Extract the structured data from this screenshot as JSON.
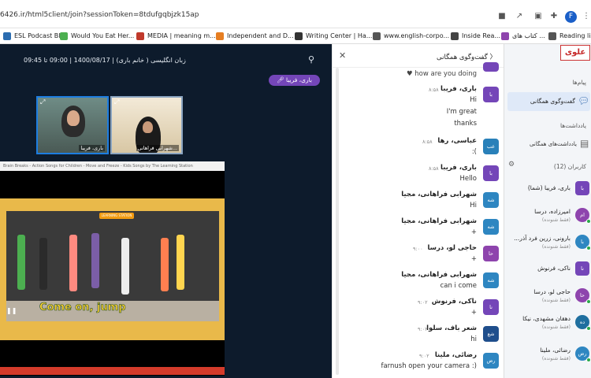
{
  "browser": {
    "url": "6426.ir/html5client/join?sessionToken=8tdufgqbjzk15ap",
    "avatar_letter": "F",
    "bookmarks": [
      {
        "label": "ESL Podcast Blog",
        "color": "#2b6cb0"
      },
      {
        "label": "Would You Eat Her...",
        "color": "#4caf50"
      },
      {
        "label": "MEDIA | meaning m...",
        "color": "#c0392b"
      },
      {
        "label": "Independent and D...",
        "color": "#e67e22"
      },
      {
        "label": "Writing Center | Ha...",
        "color": "#333333"
      },
      {
        "label": "www.english-corpo...",
        "color": "#555555"
      },
      {
        "label": "Inside Rea...",
        "color": "#444444"
      },
      {
        "label": "کتاب های ...",
        "color": "#8e44ad"
      },
      {
        "label": "Reading list",
        "color": "#555555"
      }
    ]
  },
  "session": {
    "title": "زبان انگلیسی ( خانم باری) | 1400/08/17 | 09:00 تا 09:45",
    "talking": "باری، فریبا",
    "cams": [
      {
        "name": "باری، فریبا"
      },
      {
        "name": "شهرابی فراهانی..."
      }
    ],
    "screenshare_title": "Brain Breaks - Action Songs for Children - Move and Freeze - Kids Songs by The Learning Station",
    "caption": "Come on, jump",
    "badge": "LEARNING STATION"
  },
  "chat": {
    "title": "گفت‌وگوی همگانی",
    "messages": [
      {
        "name": "",
        "time": "",
        "lines": [
          "♥ how are you doing"
        ],
        "avatar": "",
        "color": ""
      },
      {
        "name": "باری، فریبا",
        "time": "۸:۵۸",
        "lines": [
          "Hi",
          "I'm great",
          "thanks"
        ],
        "avatar": "با",
        "color": "#7446b8"
      },
      {
        "name": "عباسی، رها",
        "time": "۸:۵۸",
        "lines": [
          ":("
        ],
        "avatar": "عب",
        "color": "#2980b9"
      },
      {
        "name": "باری، فریبا",
        "time": "۸:۵۸",
        "lines": [
          "Hello"
        ],
        "avatar": "با",
        "color": "#7446b8"
      },
      {
        "name": "شهرابی فراهانی، محیا",
        "time": "۹:۰۰",
        "lines": [
          "Hi"
        ],
        "avatar": "شه",
        "color": "#2e86c1"
      },
      {
        "name": "شهرابی فراهانی، محیا",
        "time": "۹:۰۰",
        "lines": [
          "+"
        ],
        "avatar": "شه",
        "color": "#2e86c1"
      },
      {
        "name": "حاجی لو، درسا",
        "time": "۹:۰۰",
        "lines": [
          "+"
        ],
        "avatar": "حا",
        "color": "#8e44ad"
      },
      {
        "name": "شهرابی فراهانی، محیا",
        "time": "۹:۰۰",
        "lines": [
          "can i come"
        ],
        "avatar": "شه",
        "color": "#2e86c1"
      },
      {
        "name": "ناکی، فرنوش",
        "time": "۹:۰۲",
        "lines": [
          "+"
        ],
        "avatar": "نا",
        "color": "#7446b8"
      },
      {
        "name": "شعر باف، سلوا",
        "time": "۹:۰۲",
        "lines": [
          "hi"
        ],
        "avatar": "شع",
        "color": "#1f4e8c"
      },
      {
        "name": "رضائی، ملینا",
        "time": "۹:۰۲",
        "lines": [
          "farnush open your camera :)"
        ],
        "avatar": "رض",
        "color": "#2e86c1"
      }
    ]
  },
  "sidebar": {
    "logo": "علوی",
    "messages_section": "پیام‌ها",
    "public_chat": "گفت‌وگوی همگانی",
    "notes_section": "یادداشت‌ها",
    "shared_notes": "یادداشت‌های همگانی",
    "users_section": "کاربران (12)",
    "users": [
      {
        "name": "باری، فریبا (شما)",
        "status": "",
        "avatar": "با",
        "color": "#7446b8"
      },
      {
        "name": "امیرزاده، درسا",
        "status": "(فقط شنونده)",
        "avatar": "ام",
        "color": "#8e44ad"
      },
      {
        "name": "بارونی، زرین فرد آذر...",
        "status": "(فقط شنونده)",
        "avatar": "با",
        "color": "#2e86c1"
      },
      {
        "name": "ناکی، فرنوش",
        "status": "",
        "avatar": "نا",
        "color": "#7446b8"
      },
      {
        "name": "حاجی لو، درسا",
        "status": "(فقط شنونده)",
        "avatar": "حا",
        "color": "#8e44ad"
      },
      {
        "name": "دهقان مشهدی، نیکا",
        "status": "(فقط شنونده)",
        "avatar": "ده",
        "color": "#1f6f9f"
      },
      {
        "name": "رضائی، ملینا",
        "status": "(فقط شنونده)",
        "avatar": "رض",
        "color": "#2e86c1"
      }
    ]
  }
}
